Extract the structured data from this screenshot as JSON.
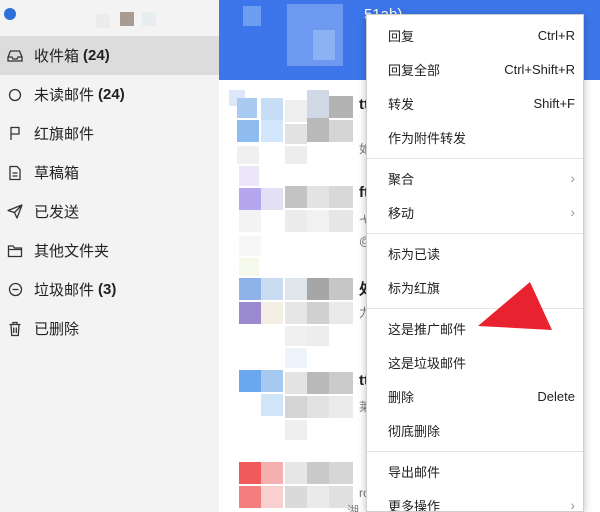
{
  "header": {
    "title_fragment": "51ab)"
  },
  "sidebar": {
    "items": [
      {
        "label": "收件箱",
        "count": "(24)",
        "icon": "inbox-icon"
      },
      {
        "label": "未读邮件",
        "count": "(24)",
        "icon": "circle-icon"
      },
      {
        "label": "红旗邮件",
        "count": "",
        "icon": "flag-icon"
      },
      {
        "label": "草稿箱",
        "count": "",
        "icon": "draft-icon"
      },
      {
        "label": "已发送",
        "count": "",
        "icon": "send-icon"
      },
      {
        "label": "其他文件夹",
        "count": "",
        "icon": "folder-icon"
      },
      {
        "label": "垃圾邮件",
        "count": "(3)",
        "icon": "junk-icon"
      },
      {
        "label": "已删除",
        "count": "",
        "icon": "trash-icon"
      }
    ]
  },
  "list_peek": [
    "tt",
    "如",
    "ft",
    "弋",
    "@",
    "处",
    "力",
    "tt",
    "莱",
    "rc",
    "湖"
  ],
  "context_menu": {
    "items": [
      {
        "label": "回复",
        "shortcut": "Ctrl+R"
      },
      {
        "label": "回复全部",
        "shortcut": "Ctrl+Shift+R"
      },
      {
        "label": "转发",
        "shortcut": "Shift+F"
      },
      {
        "label": "作为附件转发",
        "shortcut": ""
      },
      {
        "label": "聚合",
        "shortcut": ""
      },
      {
        "label": "移动",
        "shortcut": ""
      },
      {
        "label": "标为已读",
        "shortcut": ""
      },
      {
        "label": "标为红旗",
        "shortcut": ""
      },
      {
        "label": "这是推广邮件",
        "shortcut": ""
      },
      {
        "label": "这是垃圾邮件",
        "shortcut": ""
      },
      {
        "label": "删除",
        "shortcut": "Delete"
      },
      {
        "label": "彻底删除",
        "shortcut": ""
      },
      {
        "label": "导出邮件",
        "shortcut": ""
      },
      {
        "label": "更多操作",
        "shortcut": ""
      }
    ]
  },
  "colors": {
    "header": "#3c76ea",
    "annotation_arrow": "#e8232f",
    "sidebar_bg": "#f3f3f3",
    "selected_bg": "#dcdcdc"
  }
}
